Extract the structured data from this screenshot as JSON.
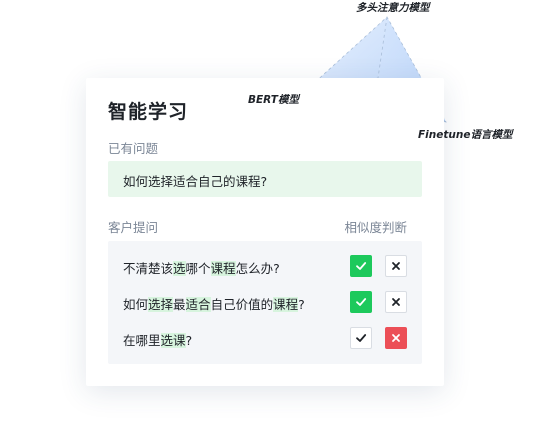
{
  "card": {
    "title": "智能学习",
    "existing_label": "已有问题",
    "existing_question": "如何选择适合自己的课程?",
    "customer_label": "客户提问",
    "similarity_label": "相似度判断"
  },
  "questions": [
    {
      "segments": [
        {
          "text": "不清楚该",
          "hl": false
        },
        {
          "text": "选",
          "hl": true
        },
        {
          "text": "哪个",
          "hl": false
        },
        {
          "text": "课程",
          "hl": true
        },
        {
          "text": "怎么办?",
          "hl": false
        }
      ],
      "judgement": "similar"
    },
    {
      "segments": [
        {
          "text": "如何",
          "hl": false
        },
        {
          "text": "选择",
          "hl": true
        },
        {
          "text": "最",
          "hl": false
        },
        {
          "text": "适合",
          "hl": true
        },
        {
          "text": "自己价值的",
          "hl": false
        },
        {
          "text": "课程",
          "hl": true
        },
        {
          "text": "?",
          "hl": false
        }
      ],
      "judgement": "similar"
    },
    {
      "segments": [
        {
          "text": "在哪里",
          "hl": false
        },
        {
          "text": "选课",
          "hl": true
        },
        {
          "text": "?",
          "hl": false
        }
      ],
      "judgement": "not_similar"
    }
  ],
  "models": {
    "top": "多头注意力模型",
    "left": "BERT模型",
    "right": "Finetune语言模型"
  },
  "colors": {
    "green": "#1dc95c",
    "red": "#ec4f57",
    "highlight": "#d7f4de",
    "existing_bg": "#e8f7ec",
    "pyramid_blue": "#cfe2fb"
  }
}
